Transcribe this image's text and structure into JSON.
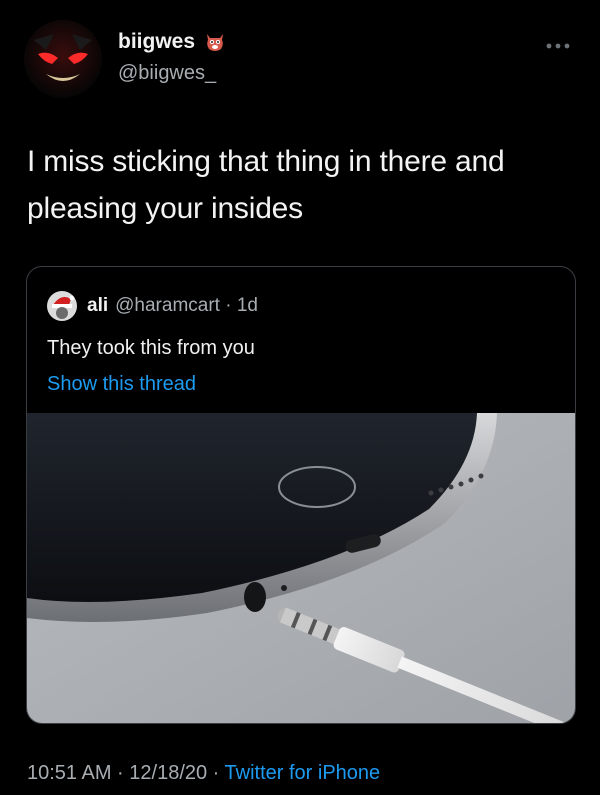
{
  "author": {
    "display_name": "biigwes",
    "handle": "@biigwes_",
    "avatar_icon": "devil-face-avatar",
    "name_emoji_icon": "oni-mask-emoji"
  },
  "tweet": {
    "text": "I miss sticking that thing in there and pleasing your insides"
  },
  "quoted_tweet": {
    "display_name": "ali",
    "handle_time": "@haramcart · 1d",
    "avatar_icon": "santa-hat-avatar",
    "text": "They took this from you",
    "show_thread": "Show this thread",
    "media_icon": "headphone-jack-phone-photo"
  },
  "meta": {
    "time_date": "10:51 AM · 12/18/20 · ",
    "source": "Twitter for iPhone"
  },
  "colors": {
    "background": "#000000",
    "link": "#1d9bf0",
    "secondary_text": "#a8adb2"
  }
}
